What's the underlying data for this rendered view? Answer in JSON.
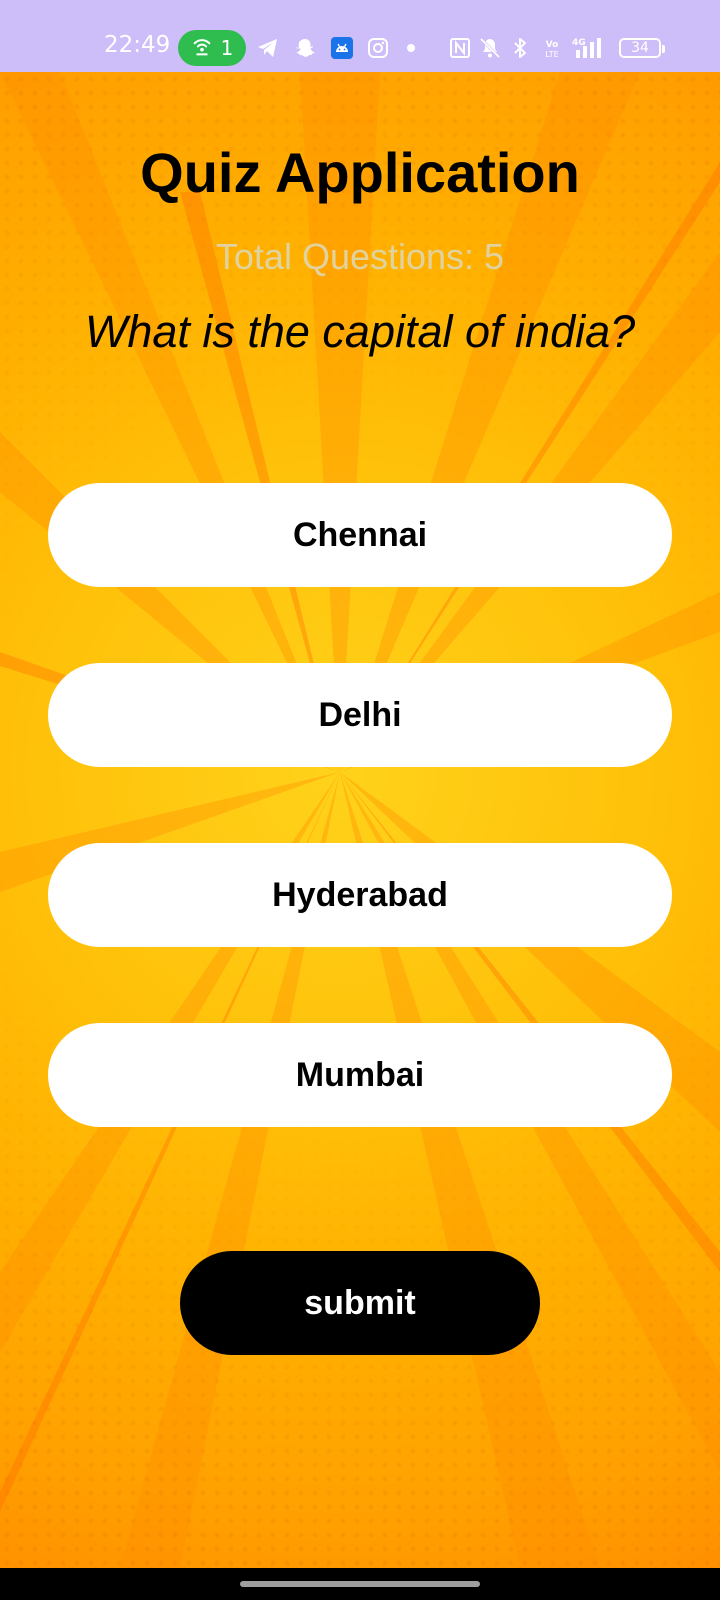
{
  "status_bar": {
    "time": "22:49",
    "hotspot_count": "1",
    "battery_level": "34",
    "icons": [
      "hotspot-icon",
      "telegram-icon",
      "snapchat-icon",
      "android-icon",
      "instagram-icon",
      "dot-icon",
      "nfc-icon",
      "mute-icon",
      "bluetooth-icon",
      "volte-icon",
      "signal-4g-icon",
      "battery-icon"
    ]
  },
  "quiz": {
    "title": "Quiz Application",
    "total_questions": "Total Questions: 5",
    "question": "What is the capital of india?",
    "options": [
      {
        "label": "Chennai"
      },
      {
        "label": "Delhi"
      },
      {
        "label": "Hyderabad"
      },
      {
        "label": "Mumbai"
      }
    ],
    "submit_label": "submit"
  },
  "colors": {
    "status_bar_bg": "#cdbdf8",
    "hotspot_pill": "#2fbd4f",
    "background_yellow": "#ffc10a",
    "option_bg": "#ffffff",
    "submit_bg": "#000000",
    "subtitle_text": "#e0d3a0"
  }
}
